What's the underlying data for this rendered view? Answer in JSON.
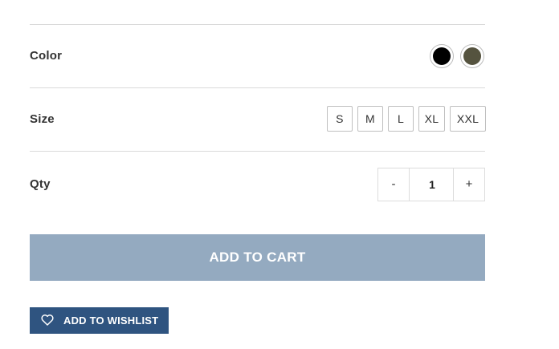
{
  "options": {
    "color": {
      "label": "Color",
      "swatches": [
        {
          "name": "Black",
          "hex": "#000000"
        },
        {
          "name": "Olive",
          "hex": "#55533f"
        }
      ]
    },
    "size": {
      "label": "Size",
      "values": [
        "S",
        "M",
        "L",
        "XL",
        "XXL"
      ]
    },
    "quantity": {
      "label": "Qty",
      "decrement": "-",
      "value": "1",
      "increment": "+"
    }
  },
  "actions": {
    "add_to_cart": "ADD TO CART",
    "add_to_wishlist": "ADD TO WISHLIST"
  },
  "colors": {
    "add_to_cart_bg": "#94aac0",
    "wishlist_bg": "#2f5480"
  },
  "icons": {
    "wishlist": "heart-outline-icon"
  }
}
